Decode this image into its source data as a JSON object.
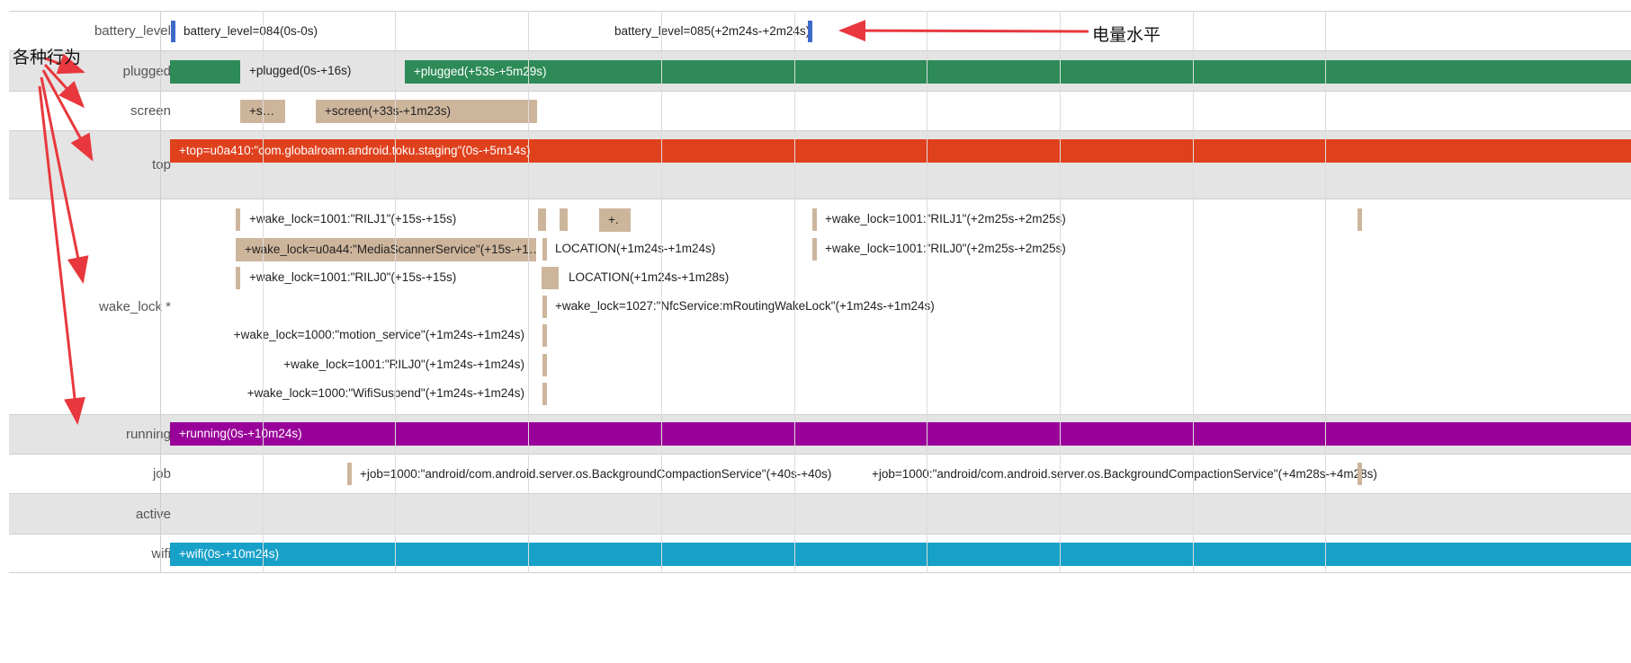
{
  "colors": {
    "battery": "#3b6ac9",
    "plugged": "#2e8b57",
    "screen": "#cdb59c",
    "top": "#e0411d",
    "wake_lock": "#cdb59c",
    "running": "#990099",
    "job": "#cdb59c",
    "wifi": "#17a0c8",
    "annotation": "#e8383d"
  },
  "lanes": {
    "battery_level": "battery_level",
    "plugged": "plugged",
    "screen": "screen",
    "top": "top",
    "wake_lock": "wake_lock *",
    "running": "running",
    "job": "job",
    "active": "active",
    "wifi": "wifi"
  },
  "battery": {
    "label_1": "battery_level=084(0s-0s)",
    "label_2": "battery_level=085(+2m24s-+2m24s)"
  },
  "plugged": {
    "label_1": "+plugged(0s-+16s)",
    "bar_2": "+plugged(+53s-+5m29s)"
  },
  "screen": {
    "bar_1": "+s…",
    "bar_2": "+screen(+33s-+1m23s)"
  },
  "top": {
    "bar_1": "+top=u0a410:\"com.globalroam.android.toku.staging\"(0s-+5m14s)"
  },
  "wake_lock": {
    "l1": "+wake_lock=1001:\"RILJ1\"(+15s-+15s)",
    "l2": "+wake_lock=u0a44:\"MediaScannerService\"(+15s-+1…",
    "l3": "+wake_lock=1001:\"RILJ0\"(+15s-+15s)",
    "l4": "+wake_lock=1000:\"motion_service\"(+1m24s-+1m24s)",
    "l5": "+wake_lock=1001:\"RILJ0\"(+1m24s-+1m24s)",
    "l6": "+wake_lock=1000:\"WifiSuspend\"(+1m24s-+1m24s)",
    "l7": "+.",
    "l8": "LOCATION(+1m24s-+1m24s)",
    "l9": "LOCATION(+1m24s-+1m28s)",
    "l10": "+wake_lock=1027:\"NfcService:mRoutingWakeLock\"(+1m24s-+1m24s)",
    "l11": "+wake_lock=1001:\"RILJ1\"(+2m25s-+2m25s)",
    "l12": "+wake_lock=1001:\"RILJ0\"(+2m25s-+2m25s)"
  },
  "running": {
    "bar_1": "+running(0s-+10m24s)"
  },
  "job": {
    "l1": "+job=1000:\"android/com.android.server.os.BackgroundCompactionService\"(+40s-+40s)",
    "l2": "+job=1000:\"android/com.android.server.os.BackgroundCompactionService\"(+4m28s-+4m28s)"
  },
  "wifi": {
    "bar_1": "+wifi(0s-+10m24s)"
  },
  "annotations": {
    "behaviors": "各种行为",
    "battery": "电量水平"
  }
}
